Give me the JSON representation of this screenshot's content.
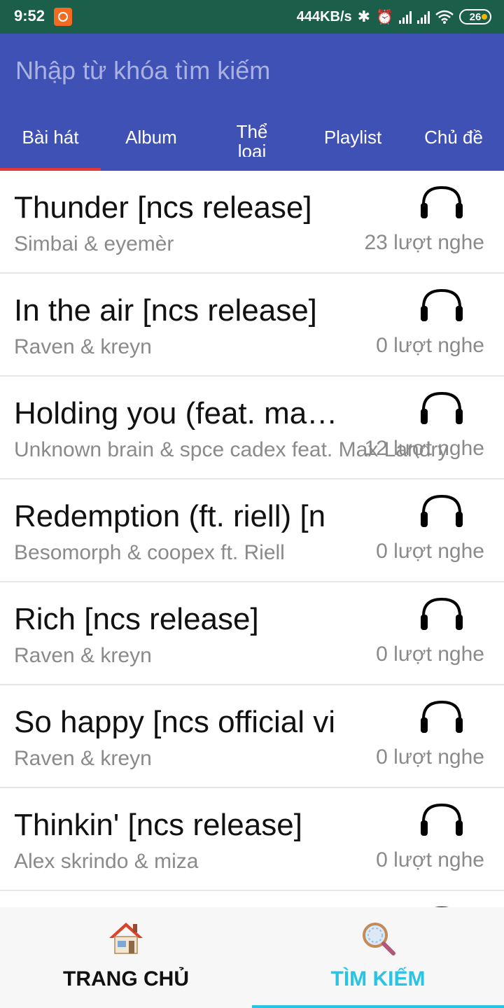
{
  "status_bar": {
    "time": "9:52",
    "network_speed": "444KB/s",
    "bluetooth_icon": "bluetooth-icon",
    "battery_level": "26"
  },
  "search": {
    "placeholder": "Nhập từ khóa tìm kiếm",
    "value": ""
  },
  "tabs": [
    {
      "label": "Bài hát",
      "selected": true
    },
    {
      "label": "Album",
      "selected": false
    },
    {
      "label": "Thể loại",
      "selected": false
    },
    {
      "label": "Playlist",
      "selected": false
    },
    {
      "label": "Chủ đề",
      "selected": false
    }
  ],
  "songs": [
    {
      "title": "Thunder [ncs release]",
      "artist": "Simbai & eyemèr",
      "listens": "23 lượt nghe"
    },
    {
      "title": "In the air [ncs release]",
      "artist": "Raven & kreyn",
      "listens": "0 lượt nghe"
    },
    {
      "title": "Holding you (feat. max…",
      "artist": "Unknown brain & spce cadex feat. Max Landry",
      "listens": "12 lượt nghe"
    },
    {
      "title": "Redemption (ft. riell) [n",
      "artist": "Besomorph & coopex ft. Riell",
      "listens": "0 lượt nghe"
    },
    {
      "title": "Rich [ncs release]",
      "artist": "Raven & kreyn",
      "listens": "0 lượt nghe"
    },
    {
      "title": "So happy [ncs official vi",
      "artist": "Raven & kreyn",
      "listens": "0 lượt nghe"
    },
    {
      "title": "Thinkin' [ncs release]",
      "artist": "Alex skrindo & miza",
      "listens": "0 lượt nghe"
    }
  ],
  "bottom_nav": {
    "home_label": "TRANG CHỦ",
    "search_label": "TÌM KIẾM",
    "home_icon": "house-icon",
    "search_icon": "magnifier-icon",
    "active": "search",
    "active_color": "#29c4e3"
  },
  "colors": {
    "app_bar": "#3f51b5",
    "status_bar": "#1b5e4a",
    "tab_indicator": "#e53935"
  }
}
